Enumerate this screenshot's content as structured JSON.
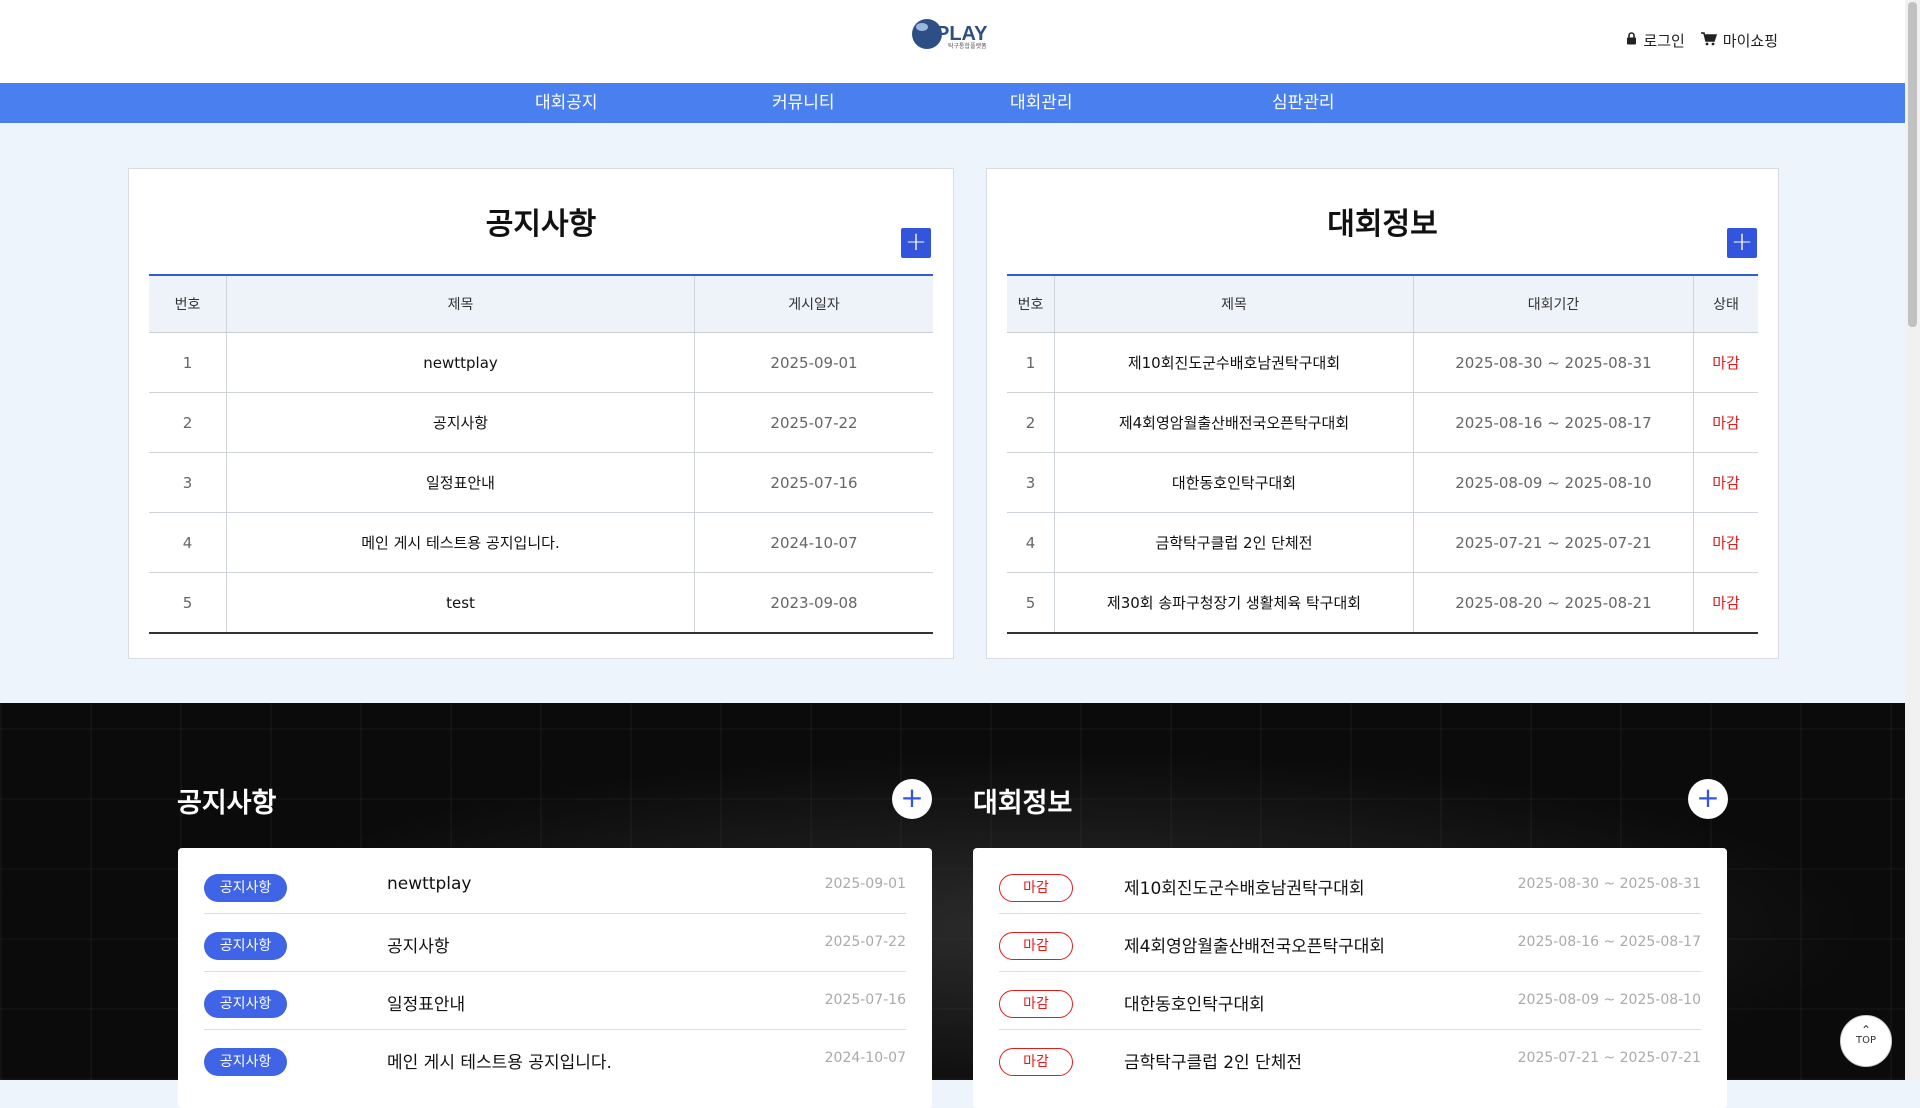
{
  "header": {
    "logo_text": "PLAY",
    "logo_sub": "탁구통합플랫폼",
    "login_label": "로그인",
    "shop_label": "마이쇼핑"
  },
  "nav": [
    "대회공지",
    "커뮤니티",
    "대회관리",
    "심판관리"
  ],
  "notice_panel": {
    "title": "공지사항",
    "plus": "+",
    "headers": [
      "번호",
      "제목",
      "게시일자"
    ],
    "rows": [
      {
        "no": "1",
        "title": "newttplay",
        "date": "2025-09-01"
      },
      {
        "no": "2",
        "title": "공지사항",
        "date": "2025-07-22"
      },
      {
        "no": "3",
        "title": "일정표안내",
        "date": "2025-07-16"
      },
      {
        "no": "4",
        "title": "메인 게시 테스트용 공지입니다.",
        "date": "2024-10-07"
      },
      {
        "no": "5",
        "title": "test",
        "date": "2023-09-08"
      }
    ]
  },
  "tournament_panel": {
    "title": "대회정보",
    "plus": "+",
    "headers": [
      "번호",
      "제목",
      "대회기간",
      "상태"
    ],
    "rows": [
      {
        "no": "1",
        "title": "제10회진도군수배호남권탁구대회",
        "period": "2025-08-30 ~ 2025-08-31",
        "status": "마감"
      },
      {
        "no": "2",
        "title": "제4회영암월출산배전국오픈탁구대회",
        "period": "2025-08-16 ~ 2025-08-17",
        "status": "마감"
      },
      {
        "no": "3",
        "title": "대한동호인탁구대회",
        "period": "2025-08-09 ~ 2025-08-10",
        "status": "마감"
      },
      {
        "no": "4",
        "title": "금학탁구클럽 2인 단체전",
        "period": "2025-07-21 ~ 2025-07-21",
        "status": "마감"
      },
      {
        "no": "5",
        "title": "제30회 송파구청장기 생활체육 탁구대회",
        "period": "2025-08-20 ~ 2025-08-21",
        "status": "마감"
      }
    ]
  },
  "dark_notice": {
    "title": "공지사항",
    "plus": "+",
    "badge": "공지사항",
    "rows": [
      {
        "title": "newttplay",
        "date": "2025-09-01"
      },
      {
        "title": "공지사항",
        "date": "2025-07-22"
      },
      {
        "title": "일정표안내",
        "date": "2025-07-16"
      },
      {
        "title": "메인 게시 테스트용 공지입니다.",
        "date": "2024-10-07"
      }
    ]
  },
  "dark_tournament": {
    "title": "대회정보",
    "plus": "+",
    "badge": "마감",
    "rows": [
      {
        "title": "제10회진도군수배호남권탁구대회",
        "period": "2025-08-30 ~ 2025-08-31"
      },
      {
        "title": "제4회영암월출산배전국오픈탁구대회",
        "period": "2025-08-16 ~ 2025-08-17"
      },
      {
        "title": "대한동호인탁구대회",
        "period": "2025-08-09 ~ 2025-08-10"
      },
      {
        "title": "금학탁구클럽 2인 단체전",
        "period": "2025-07-21 ~ 2025-07-21"
      }
    ]
  },
  "top_button": {
    "arrow": "⌃",
    "label": "TOP"
  },
  "colors": {
    "nav": "#4a7ff0",
    "accent": "#3355dd",
    "status_red": "#e31b1b"
  }
}
